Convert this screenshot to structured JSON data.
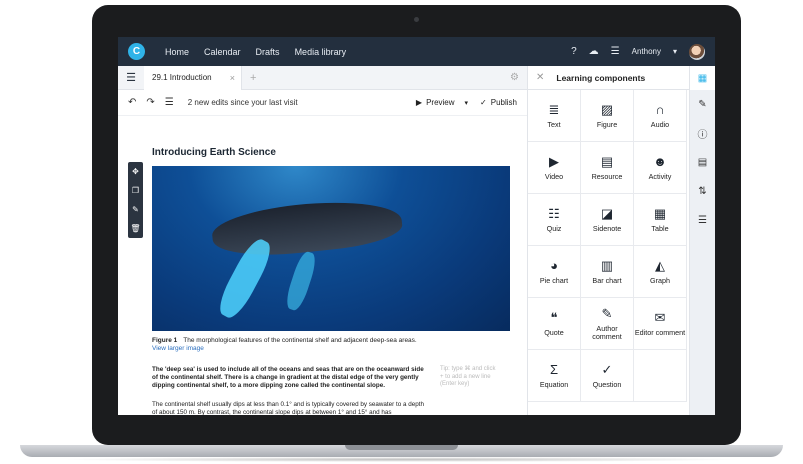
{
  "topnav": {
    "logo": "C",
    "items": [
      "Home",
      "Calendar",
      "Drafts",
      "Media library"
    ],
    "help": "?",
    "user": "Anthony"
  },
  "tabbar": {
    "tab_label": "29.1 Introduction",
    "close": "×",
    "add": "+"
  },
  "toolbar": {
    "edits_text": "2 new edits since your last visit",
    "preview_label": "Preview",
    "publish_label": "Publish"
  },
  "document": {
    "title": "Introducing Earth Science",
    "figure_label": "Figure 1",
    "figure_caption": "The morphological features of the continental shelf and adjacent deep-sea areas.",
    "figure_link": "View larger image",
    "para1": "The 'deep sea' is used to include all of the oceans and seas that are on the oceanward side of the continental shelf. There is a change in gradient at the distal edge of the very gently dipping continental shelf, to a more dipping zone called the continental slope.",
    "para2": "The continental shelf usually dips at less than 0.1° and is typically covered by seawater to a depth of about 150 m. By contrast, the continental slope dips at between 1° and 15° and has",
    "sidenote": "Tip: type ⌘ and click + to add a new line (Enter key)"
  },
  "panel": {
    "title": "Learning components",
    "components": [
      {
        "label": "Text",
        "icon": "≣"
      },
      {
        "label": "Figure",
        "icon": "▨"
      },
      {
        "label": "Audio",
        "icon": "∩"
      },
      {
        "label": "Video",
        "icon": "▶"
      },
      {
        "label": "Resource",
        "icon": "▤"
      },
      {
        "label": "Activity",
        "icon": "☻"
      },
      {
        "label": "Quiz",
        "icon": "☷"
      },
      {
        "label": "Sidenote",
        "icon": "◪"
      },
      {
        "label": "Table",
        "icon": "▦"
      },
      {
        "label": "Pie chart",
        "icon": "◕"
      },
      {
        "label": "Bar chart",
        "icon": "▥"
      },
      {
        "label": "Graph",
        "icon": "◭"
      },
      {
        "label": "Quote",
        "icon": "❝"
      },
      {
        "label": "Author comment",
        "icon": "✎"
      },
      {
        "label": "Editor comment",
        "icon": "✉"
      },
      {
        "label": "Equation",
        "icon": "Σ"
      },
      {
        "label": "Question",
        "icon": "✓"
      },
      {
        "label": "",
        "icon": ""
      }
    ]
  }
}
